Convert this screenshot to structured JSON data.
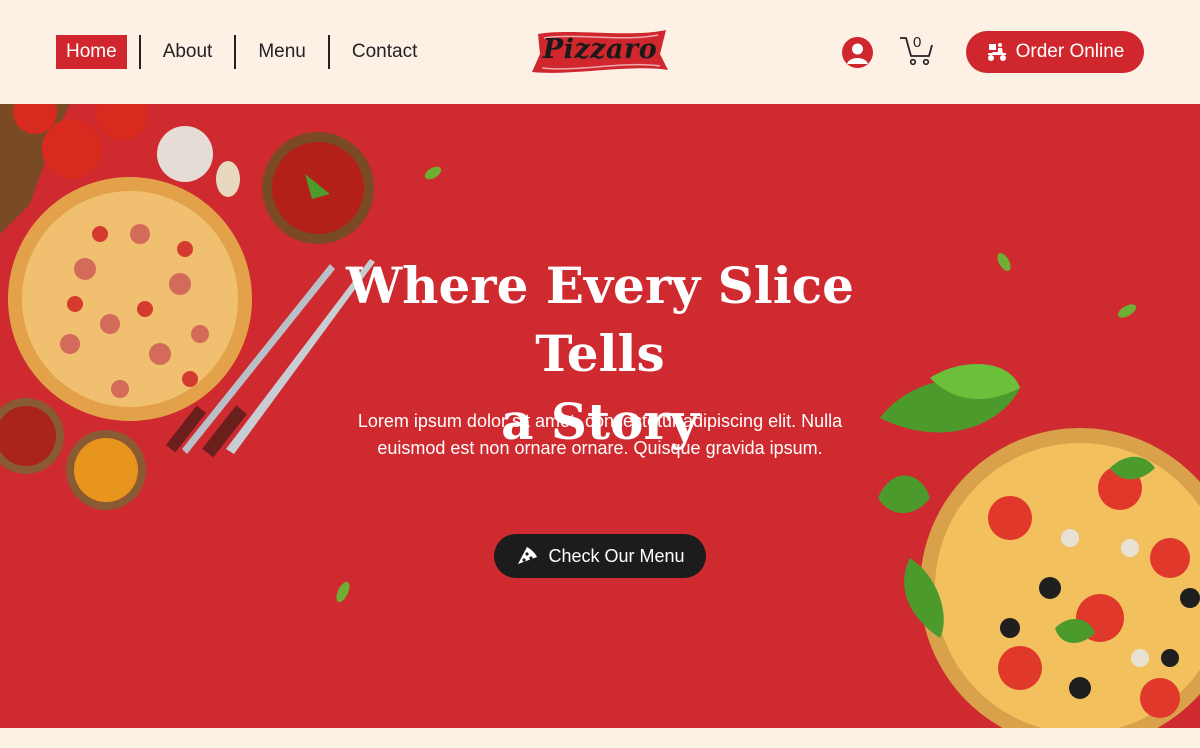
{
  "nav": {
    "items": [
      {
        "label": "Home",
        "active": true
      },
      {
        "label": "About",
        "active": false
      },
      {
        "label": "Menu",
        "active": false
      },
      {
        "label": "Contact",
        "active": false
      }
    ]
  },
  "brand": {
    "name": "Pizzaro"
  },
  "header": {
    "user_icon": "user-icon",
    "cart_icon": "cart-icon",
    "cart_count": "0",
    "order_label": "Order Online",
    "order_icon": "delivery-scooter-icon"
  },
  "hero": {
    "title_line1": "Where Every Slice Tells",
    "title_line2": "a Story",
    "body": "Lorem ipsum dolor sit amet, consectetur adipiscing elit. Nulla euismod est non ornare ornare. Quisque gravida ipsum.",
    "cta_label": "Check Our Menu",
    "cta_icon": "pizza-slice-icon"
  },
  "colors": {
    "accent": "#d0272e",
    "hero_bg": "#cf2a2f",
    "cream": "#fdf1e6",
    "dark": "#1c1c1c"
  }
}
